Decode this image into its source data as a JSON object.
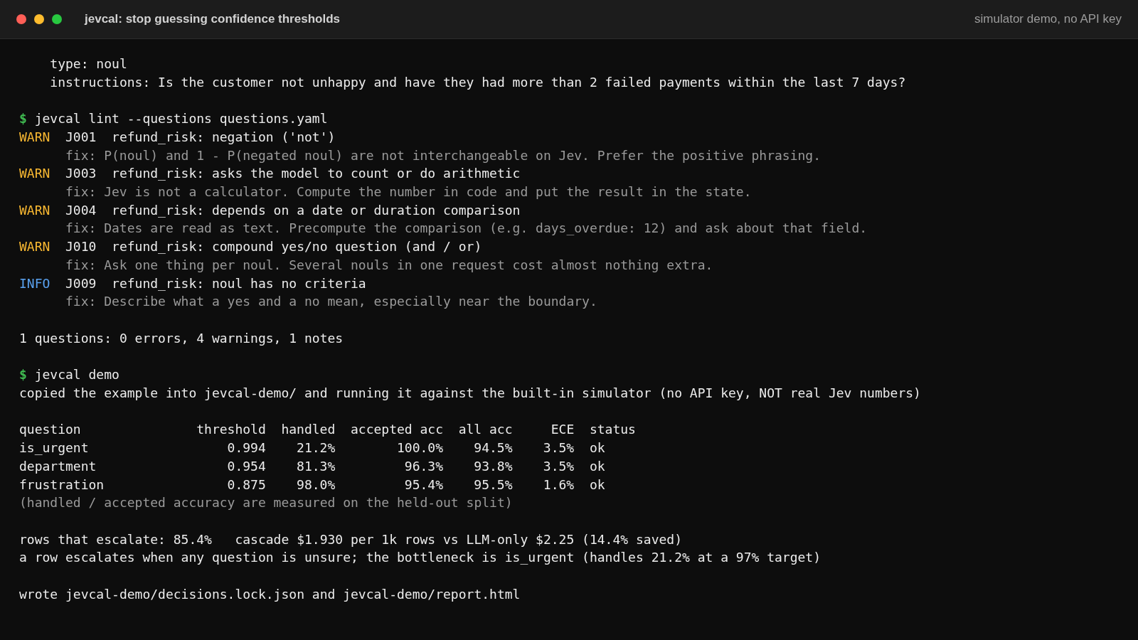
{
  "window": {
    "title": "jevcal: stop guessing confidence thresholds",
    "subtitle": "simulator demo, no API key"
  },
  "yaml_lines": [
    "type: noul",
    "instructions: Is the customer not unhappy and have they had more than 2 failed payments within the last 7 days?"
  ],
  "lint": {
    "prompt": "$",
    "command": "jevcal lint --questions questions.yaml",
    "findings": [
      {
        "kind": "warn",
        "severity": "WARN",
        "code": "J001",
        "message": "refund_risk: negation ('not')",
        "fix": "fix: P(noul) and 1 - P(negated noul) are not interchangeable on Jev. Prefer the positive phrasing."
      },
      {
        "kind": "warn",
        "severity": "WARN",
        "code": "J003",
        "message": "refund_risk: asks the model to count or do arithmetic",
        "fix": "fix: Jev is not a calculator. Compute the number in code and put the result in the state."
      },
      {
        "kind": "warn",
        "severity": "WARN",
        "code": "J004",
        "message": "refund_risk: depends on a date or duration comparison",
        "fix": "fix: Dates are read as text. Precompute the comparison (e.g. days_overdue: 12) and ask about that field."
      },
      {
        "kind": "warn",
        "severity": "WARN",
        "code": "J010",
        "message": "refund_risk: compound yes/no question (and / or)",
        "fix": "fix: Ask one thing per noul. Several nouls in one request cost almost nothing extra."
      },
      {
        "kind": "info",
        "severity": "INFO",
        "code": "J009",
        "message": "refund_risk: noul has no criteria",
        "fix": "fix: Describe what a yes and a no mean, especially near the boundary."
      }
    ],
    "summary": "1 questions: 0 errors, 4 warnings, 1 notes"
  },
  "demo": {
    "prompt": "$",
    "command": "jevcal demo",
    "message": "copied the example into jevcal-demo/ and running it against the built-in simulator (no API key, NOT real Jev numbers)",
    "table": {
      "columns": [
        "question",
        "threshold",
        "handled",
        "accepted acc",
        "all acc",
        "ECE",
        "status"
      ],
      "rows": [
        [
          "is_urgent",
          "0.994",
          "21.2%",
          "100.0%",
          "94.5%",
          "3.5%",
          "ok"
        ],
        [
          "department",
          "0.954",
          "81.3%",
          "96.3%",
          "93.8%",
          "3.5%",
          "ok"
        ],
        [
          "frustration",
          "0.875",
          "98.0%",
          "95.4%",
          "95.5%",
          "1.6%",
          "ok"
        ]
      ]
    },
    "note": "(handled / accepted accuracy are measured on the held-out split)",
    "summary_lines": [
      "rows that escalate: 85.4%   cascade $1.930 per 1k rows vs LLM-only $2.25 (14.4% saved)",
      "a row escalates when any question is unsure; the bottleneck is is_urgent (handles 21.2% at a 97% target)"
    ],
    "output": "wrote jevcal-demo/decisions.lock.json and jevcal-demo/report.html"
  }
}
